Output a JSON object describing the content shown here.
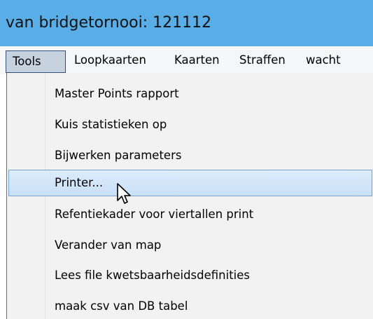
{
  "window": {
    "title": "van bridgetornooi: 121112"
  },
  "menubar": {
    "items": [
      {
        "label": "Tools",
        "active": true
      },
      {
        "label": "Loopkaarten"
      },
      {
        "label": "Kaarten"
      },
      {
        "label": "Straffen"
      },
      {
        "label": "wacht"
      }
    ]
  },
  "tools_menu": {
    "items": [
      {
        "label": "Master Points rapport"
      },
      {
        "label": "Kuis statistieken op"
      },
      {
        "label": "Bijwerken parameters"
      },
      {
        "label": "Printer...",
        "highlighted": true
      },
      {
        "label": "Refentiekader voor viertallen print"
      },
      {
        "label": "Verander van map"
      },
      {
        "label": "Lees file kwetsbaarheidsdefinities"
      },
      {
        "label": "maak csv van DB tabel"
      }
    ]
  },
  "colors": {
    "titlebar": "#5aaee7",
    "menubar": "#f5f6f7",
    "menu_background": "#f2f2f2",
    "highlight": "#c9e0f7"
  },
  "icons": {
    "cursor": "mouse-pointer-icon"
  }
}
